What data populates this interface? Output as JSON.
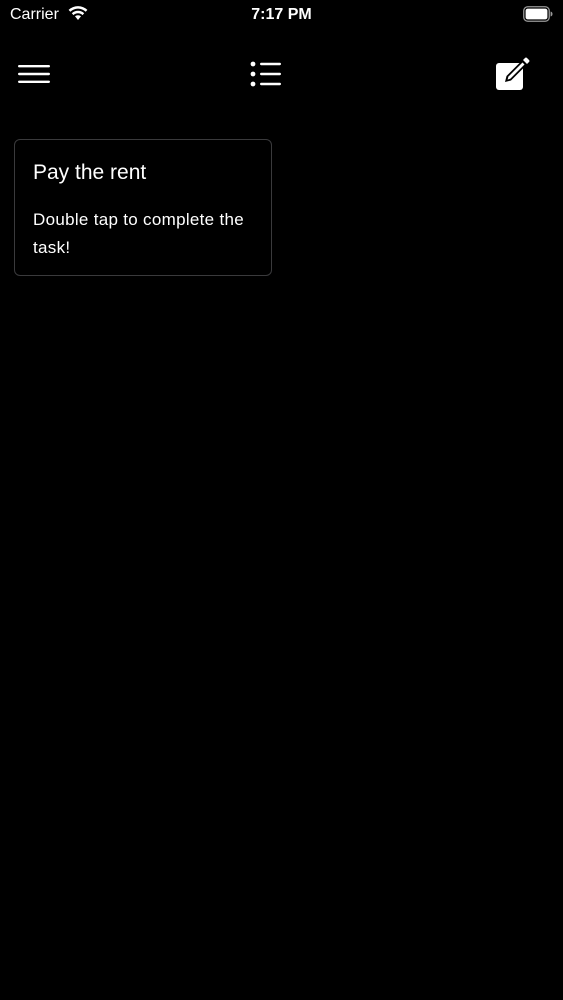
{
  "status_bar": {
    "carrier": "Carrier",
    "time": "7:17 PM",
    "wifi_icon": "wifi-icon",
    "battery_icon": "battery-full-icon"
  },
  "toolbar": {
    "menu_icon": "hamburger-menu-icon",
    "list_icon": "list-icon",
    "compose_icon": "compose-icon"
  },
  "tasks": [
    {
      "title": "Pay the rent",
      "hint": "Double tap to complete the task!"
    }
  ],
  "colors": {
    "background": "#000000",
    "text": "#ffffff",
    "card_border": "#3a3a3c"
  }
}
